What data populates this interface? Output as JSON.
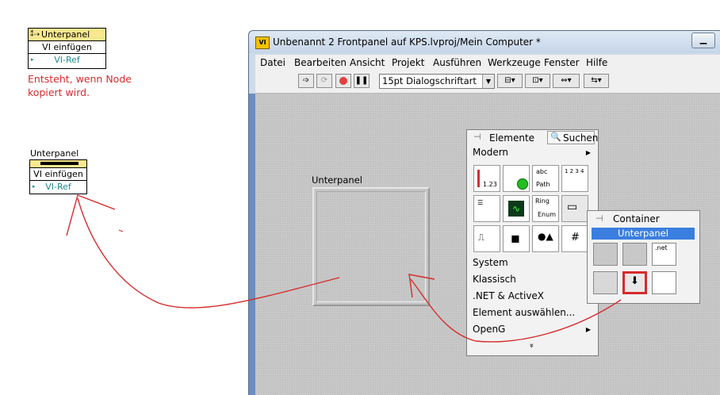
{
  "node1": {
    "title": "Unterpanel",
    "row1": "VI einfügen",
    "row2": "VI-Ref"
  },
  "note": {
    "line1": "Entsteht, wenn Node",
    "line2": "kopiert wird."
  },
  "node2": {
    "label": "Unterpanel",
    "row1": "VI einfügen",
    "row2": "VI-Ref"
  },
  "window": {
    "title": "Unbenannt 2 Frontpanel auf KPS.lvproj/Mein Computer *",
    "app_icon": "VI",
    "menu": [
      "Datei",
      "Bearbeiten",
      "Ansicht",
      "Projekt",
      "Ausführen",
      "Werkzeuge",
      "Fenster",
      "Hilfe"
    ],
    "font_select": "15pt Dialogschriftart",
    "subpanel_label": "Unterpanel"
  },
  "palette": {
    "title": "Elemente",
    "search": "Suchen",
    "category": "Modern",
    "icon_labels": {
      "numeric": "1.23",
      "string": "abc",
      "path": "Path",
      "ring": "Ring",
      "enum": "Enum",
      "numbers": "1 2 3 4",
      "hash": "#"
    },
    "items": [
      "System",
      "Klassisch",
      ".NET & ActiveX",
      "Element auswählen...",
      "OpenG"
    ],
    "more": "»"
  },
  "container": {
    "title": "Container",
    "selected": "Unterpanel",
    "net_label": ".net"
  },
  "colors": {
    "note_red": "#d62b2b",
    "teal": "#1f8a8a",
    "selection": "#3a7ee0",
    "node_header": "#f8e88e"
  }
}
